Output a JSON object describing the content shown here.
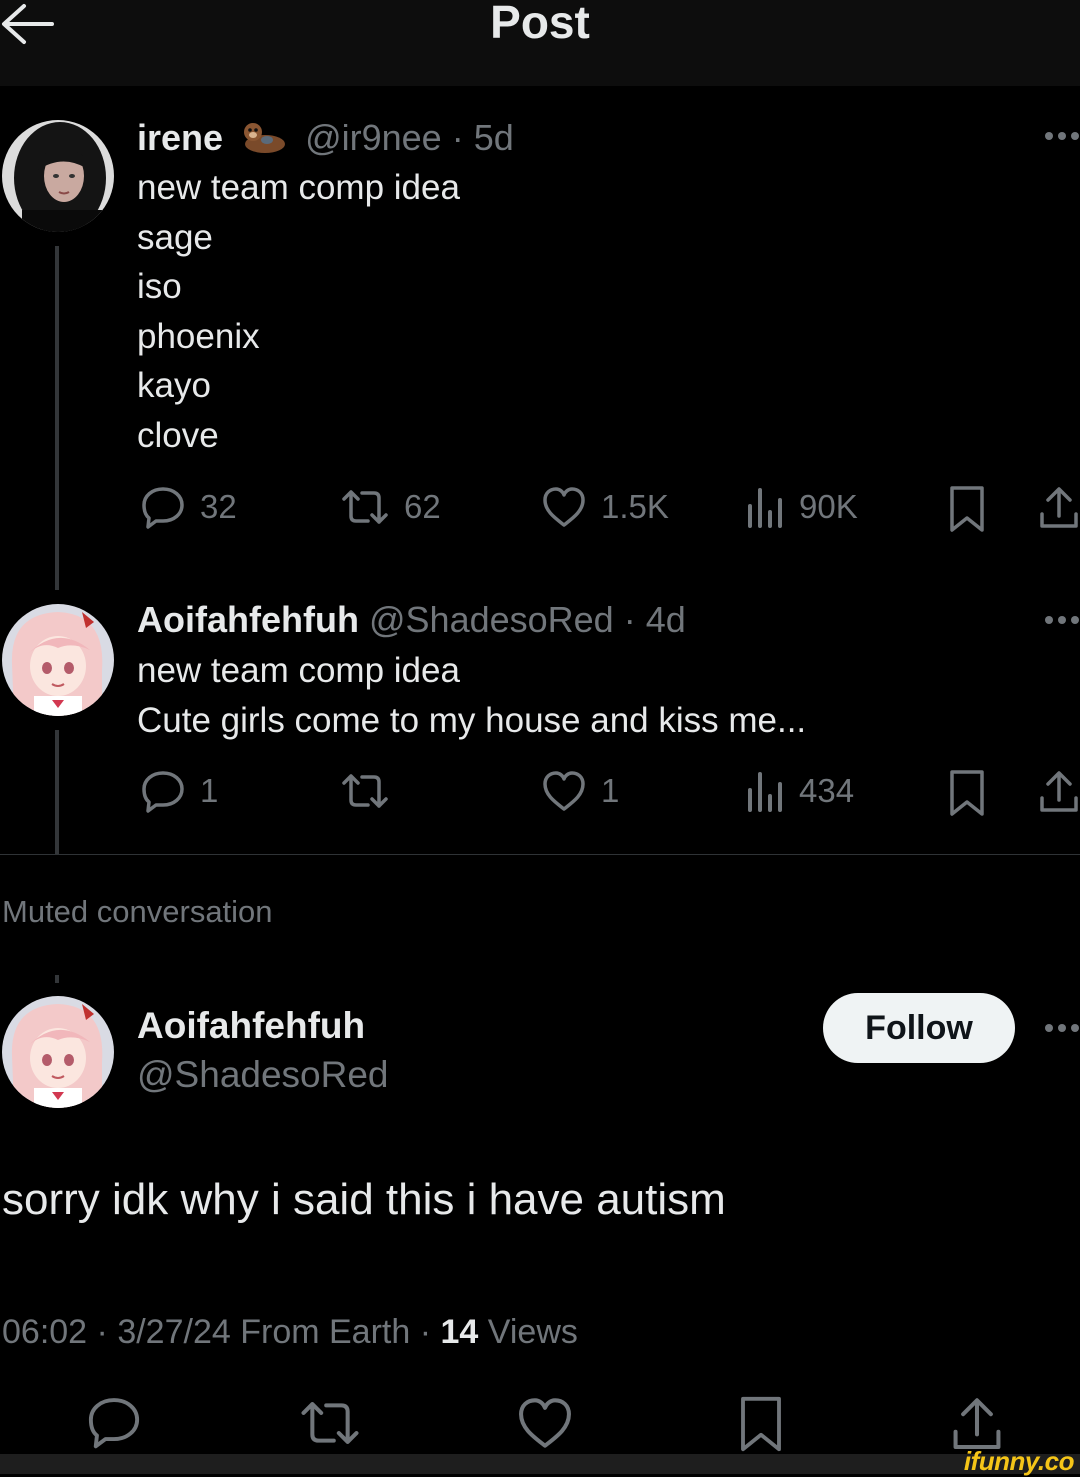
{
  "header": {
    "title": "Post"
  },
  "tweets": [
    {
      "name": "irene",
      "handle": "@ir9nee",
      "time": "5d",
      "lines": [
        "new team comp idea",
        "sage",
        "iso",
        "phoenix",
        "kayo",
        "clove"
      ],
      "stats": {
        "replies": "32",
        "retweets": "62",
        "likes": "1.5K",
        "views": "90K"
      }
    },
    {
      "name": "Aoifahfehfuh",
      "handle": "@ShadesoRed",
      "time": "4d",
      "lines": [
        "new team comp idea",
        "Cute girls come to my house and kiss me..."
      ],
      "stats": {
        "replies": "1",
        "retweets": "",
        "likes": "1",
        "views": "434"
      }
    }
  ],
  "muted_label": "Muted conversation",
  "main_post": {
    "name": "Aoifahfehfuh",
    "handle": "@ShadesoRed",
    "follow_label": "Follow",
    "text": "sorry idk why i said this i have autism",
    "time": "06:02",
    "date": "3/27/24",
    "location": "From Earth",
    "views_count": "14",
    "views_label": "Views"
  },
  "separator": "·",
  "watermark": "ifunny.co",
  "colors": {
    "background": "#000000",
    "text": "#e7e9ea",
    "muted": "#71767b",
    "follow_bg": "#eff3f4"
  }
}
